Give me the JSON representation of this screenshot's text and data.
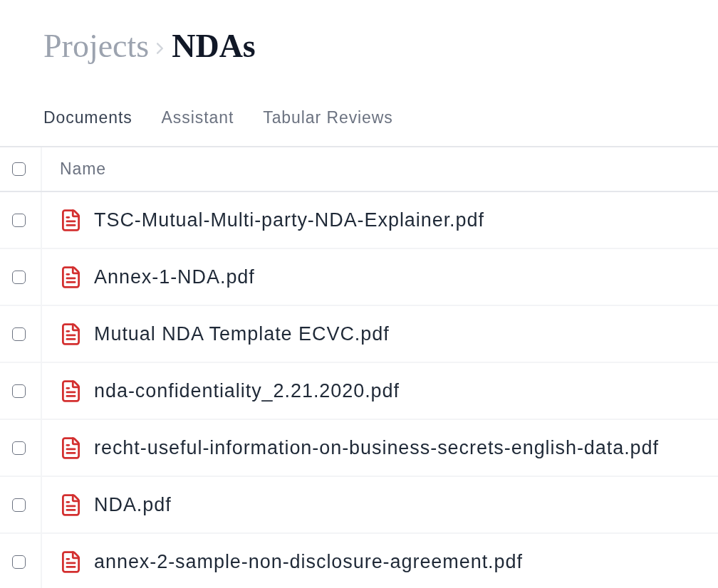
{
  "breadcrumb": [
    {
      "label": "Projects",
      "current": false
    },
    {
      "label": "NDAs",
      "current": true
    }
  ],
  "tabs": [
    {
      "label": "Documents",
      "selected": true
    },
    {
      "label": "Assistant",
      "selected": false
    },
    {
      "label": "Tabular Reviews",
      "selected": false
    }
  ],
  "table": {
    "select_all": {
      "checked": false
    },
    "columns": [
      "Name"
    ],
    "rows": [
      {
        "name": "TSC-Mutual-Multi-party-NDA-Explainer.pdf",
        "checked": false
      },
      {
        "name": "Annex-1-NDA.pdf",
        "checked": false
      },
      {
        "name": "Mutual NDA Template ECVC.pdf",
        "checked": false
      },
      {
        "name": "nda-confidentiality_2.21.2020.pdf",
        "checked": false
      },
      {
        "name": "recht-useful-information-on-business-secrets-english-data.pdf",
        "checked": false
      },
      {
        "name": "NDA.pdf",
        "checked": false
      },
      {
        "name": "annex-2-sample-non-disclosure-agreement.pdf",
        "checked": false
      }
    ]
  }
}
